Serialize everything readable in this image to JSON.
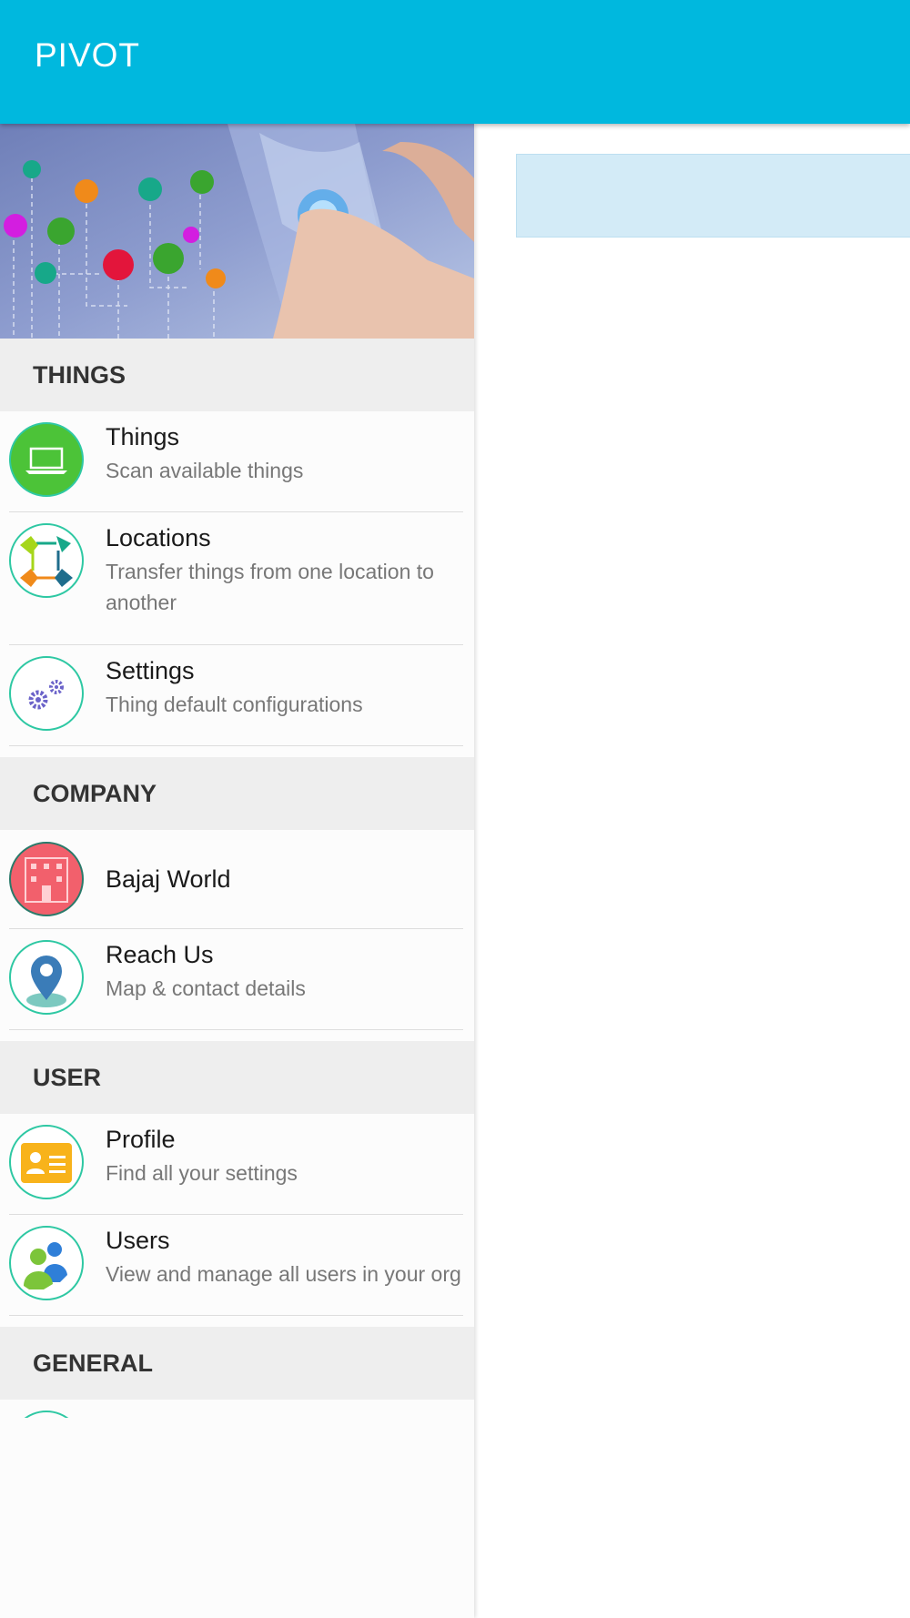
{
  "app": {
    "title": "PIVOT"
  },
  "drawer": {
    "sections": [
      {
        "title": "THINGS",
        "items": [
          {
            "title": "Things",
            "subtitle": "Scan available things",
            "icon": "laptop-icon"
          },
          {
            "title": "Locations",
            "subtitle": "Transfer things from one location to another",
            "icon": "transfer-icon"
          },
          {
            "title": "Settings",
            "subtitle": "Thing default configurations",
            "icon": "gears-icon"
          }
        ]
      },
      {
        "title": "COMPANY",
        "items": [
          {
            "title": "Bajaj World",
            "subtitle": "",
            "icon": "building-icon"
          },
          {
            "title": "Reach Us",
            "subtitle": "Map & contact details",
            "icon": "map-pin-icon"
          }
        ]
      },
      {
        "title": "USER",
        "items": [
          {
            "title": "Profile",
            "subtitle": "Find all your settings",
            "icon": "id-card-icon"
          },
          {
            "title": "Users",
            "subtitle": "View and manage all users in your org",
            "icon": "users-icon"
          }
        ]
      },
      {
        "title": "GENERAL",
        "items": []
      }
    ]
  },
  "colors": {
    "app_bar": "#00b8de",
    "section_bg": "#eeeeee",
    "icon_ring": "#2ec8a3",
    "info_banner": "#d3ebf7"
  }
}
